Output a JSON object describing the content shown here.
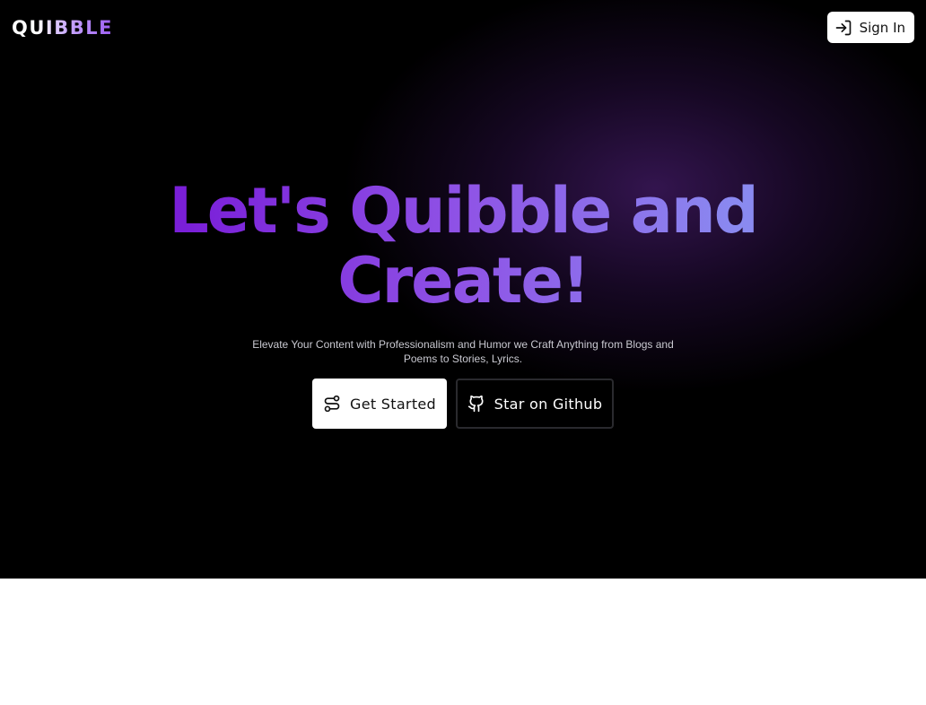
{
  "header": {
    "logo": "QUIBBLE",
    "sign_in_label": "Sign In",
    "sign_in_icon": "log-in-icon"
  },
  "hero": {
    "headline_line1": "Let's Quibble and",
    "headline_line2": "Create!",
    "subtitle": "Elevate Your Content with Professionalism and Humor we Craft Anything from Blogs and Poems to Stories, Lyrics.",
    "primary_button": {
      "label": "Get Started",
      "icon": "route-icon"
    },
    "secondary_button": {
      "label": "Star on Github",
      "icon": "github-icon"
    }
  },
  "colors": {
    "hero_background": "#000000",
    "accent_purple": "#7a1fd8",
    "accent_lavender": "#8a8af0",
    "button_white": "#ffffff"
  }
}
